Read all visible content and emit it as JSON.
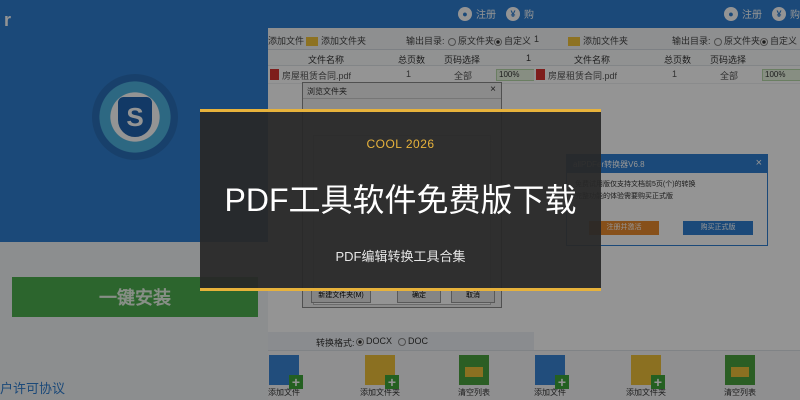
{
  "installer": {
    "title_fragment": "r",
    "install_button": "一键安装",
    "license_link": "户许可协议"
  },
  "app": {
    "header": {
      "register": "注册",
      "currency_short": "¥",
      "purchase": "购"
    },
    "toolbar": {
      "add_file": "添加文件",
      "add_folder": "添加文件夹",
      "output_dir_label": "输出目录:",
      "option_original": "原文件夹",
      "option_custom": "自定义",
      "page_char": "1"
    },
    "columns": {
      "file_name": "文件名称",
      "total_pages": "总页数",
      "page_select": "页码选择",
      "status_char": "1"
    },
    "row": {
      "file_name": "房屋租赁合同.pdf",
      "pages": "1",
      "page_range": "全部",
      "progress_label": "100%"
    },
    "format": {
      "label": "转换格式:",
      "docx": "DOCX",
      "doc": "DOC"
    },
    "bottom_tools": [
      "添加文件",
      "添加文件夹",
      "清空列表"
    ]
  },
  "dialog": {
    "title": "浏览文件夹",
    "close": "×",
    "buttons": {
      "new_folder": "新建文件夹(M)",
      "ok": "确定",
      "cancel": "取消"
    }
  },
  "popup": {
    "title": "allPDFer转换器V6.8",
    "close": "×",
    "line1": "免费试用版仅支持文档前5页(个)的转换",
    "line2": "完整功能的体验需要购买正式版",
    "btn_register": "注册并激活",
    "btn_buy": "购买正式版"
  },
  "banner": {
    "kicker": "COOL 2026",
    "headline": "PDF工具软件免费版下载",
    "subtitle": "PDF编辑转换工具合集"
  },
  "colors": {
    "accent_gold": "#e7b23b",
    "app_blue": "#2f7fd0",
    "install_green": "#4cae4f"
  }
}
